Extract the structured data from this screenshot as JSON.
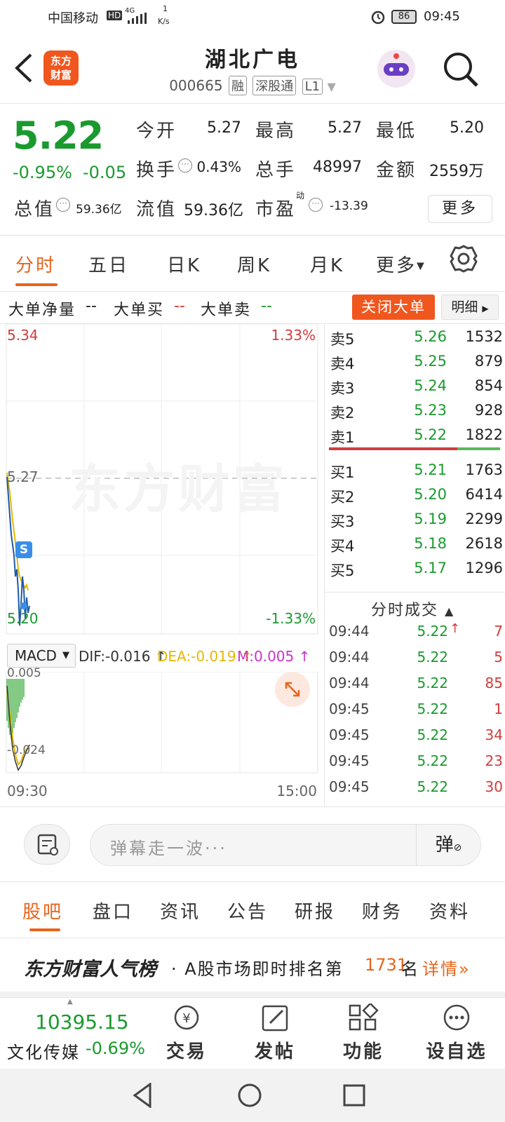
{
  "status_bar": {
    "carrier": "中国移动",
    "hd": "HD",
    "net": "4G",
    "speed_value": "1",
    "speed_unit": "K/s",
    "battery": "86",
    "time": "09:45"
  },
  "header": {
    "back_icon": "chevron-left-icon",
    "logo_line1": "东方",
    "logo_line2": "财富",
    "title": "湖北广电",
    "code": "000665",
    "tags": [
      "融",
      "深股通",
      "L1"
    ],
    "search_icon": "search-icon"
  },
  "quote": {
    "price": "5.22",
    "change_pct": "-0.95%",
    "change": "-0.05",
    "open_label": "今开",
    "open_value": "5.27",
    "high_label": "最高",
    "high_value": "5.27",
    "low_label": "最低",
    "low_value": "5.20",
    "turnover_label": "换手",
    "turnover_value": "0.43%",
    "volume_label": "总手",
    "volume_value": "48997",
    "amount_label": "金额",
    "amount_value": "2559万",
    "mktcap_label": "总值",
    "mktcap_value": "59.36亿",
    "float_label": "流值",
    "float_value": "59.36亿",
    "pe_label": "市盈",
    "pe_sup": "动",
    "pe_value": "-13.39",
    "more_label": "更多"
  },
  "tabs": [
    "分时",
    "五日",
    "日K",
    "周K",
    "月K",
    "更多"
  ],
  "big_order": {
    "net_label": "大单净量",
    "net_value": "--",
    "buy_label": "大单买",
    "buy_value": "--",
    "sell_label": "大单卖",
    "sell_value": "--",
    "close_label": "关闭大单",
    "detail_label": "明细"
  },
  "chart_axis": {
    "top_price": "5.34",
    "top_pct": "1.33%",
    "mid_price": "5.27",
    "bottom_price": "5.20",
    "bottom_pct": "-1.33%",
    "watermark": "东方财富",
    "s_marker": "S"
  },
  "order_book": {
    "asks": [
      {
        "name": "卖5",
        "price": "5.26",
        "vol": "1532"
      },
      {
        "name": "卖4",
        "price": "5.25",
        "vol": "879"
      },
      {
        "name": "卖3",
        "price": "5.24",
        "vol": "854"
      },
      {
        "name": "卖2",
        "price": "5.23",
        "vol": "928"
      },
      {
        "name": "卖1",
        "price": "5.22",
        "vol": "1822"
      }
    ],
    "bids": [
      {
        "name": "买1",
        "price": "5.21",
        "vol": "1763"
      },
      {
        "name": "买2",
        "price": "5.20",
        "vol": "6414"
      },
      {
        "name": "买3",
        "price": "5.19",
        "vol": "2299"
      },
      {
        "name": "买4",
        "price": "5.18",
        "vol": "2618"
      },
      {
        "name": "买5",
        "price": "5.17",
        "vol": "1296"
      }
    ],
    "sell_ratio": 0.75
  },
  "trades": {
    "title": "分时成交",
    "rows": [
      {
        "time": "09:44",
        "price": "5.22",
        "vol": "7",
        "arrow": "↑"
      },
      {
        "time": "09:44",
        "price": "5.22",
        "vol": "5",
        "arrow": ""
      },
      {
        "time": "09:44",
        "price": "5.22",
        "vol": "85",
        "arrow": ""
      },
      {
        "time": "09:45",
        "price": "5.22",
        "vol": "1",
        "arrow": ""
      },
      {
        "time": "09:45",
        "price": "5.22",
        "vol": "34",
        "arrow": ""
      },
      {
        "time": "09:45",
        "price": "5.22",
        "vol": "23",
        "arrow": ""
      },
      {
        "time": "09:45",
        "price": "5.22",
        "vol": "30",
        "arrow": ""
      }
    ]
  },
  "macd": {
    "selector": "MACD",
    "dif": "DIF:-0.016",
    "dea": "DEA:-0.019",
    "m": "M:0.005",
    "top": "0.005",
    "bottom": "-0.024",
    "colors": {
      "dif": "#333333",
      "dea": "#e6b800",
      "m": "#cc33cc"
    }
  },
  "time_axis": {
    "start": "09:30",
    "end": "15:00"
  },
  "comment": {
    "placeholder": "弹幕走一波···",
    "danmu_label": "弹"
  },
  "section_tabs": [
    "股吧",
    "盘口",
    "资讯",
    "公告",
    "研报",
    "财务",
    "资料"
  ],
  "ranking": {
    "brand": "东方财富人气榜",
    "text_prefix": "· A股市场即时排名第",
    "rank": "1731",
    "text_suffix": "名",
    "detail": "详情"
  },
  "bottom_nav": {
    "index_value": "10395.15",
    "index_name": "文化传媒",
    "index_change": "-0.69%",
    "items": [
      {
        "label": "交易",
        "icon": "yen-exchange-icon"
      },
      {
        "label": "发帖",
        "icon": "edit-icon"
      },
      {
        "label": "功能",
        "icon": "grid-icon"
      },
      {
        "label": "设自选",
        "icon": "more-dots-icon"
      }
    ]
  },
  "colors": {
    "accent": "#e9641a",
    "up": "#d23c3c",
    "down": "#1a9a2e"
  }
}
